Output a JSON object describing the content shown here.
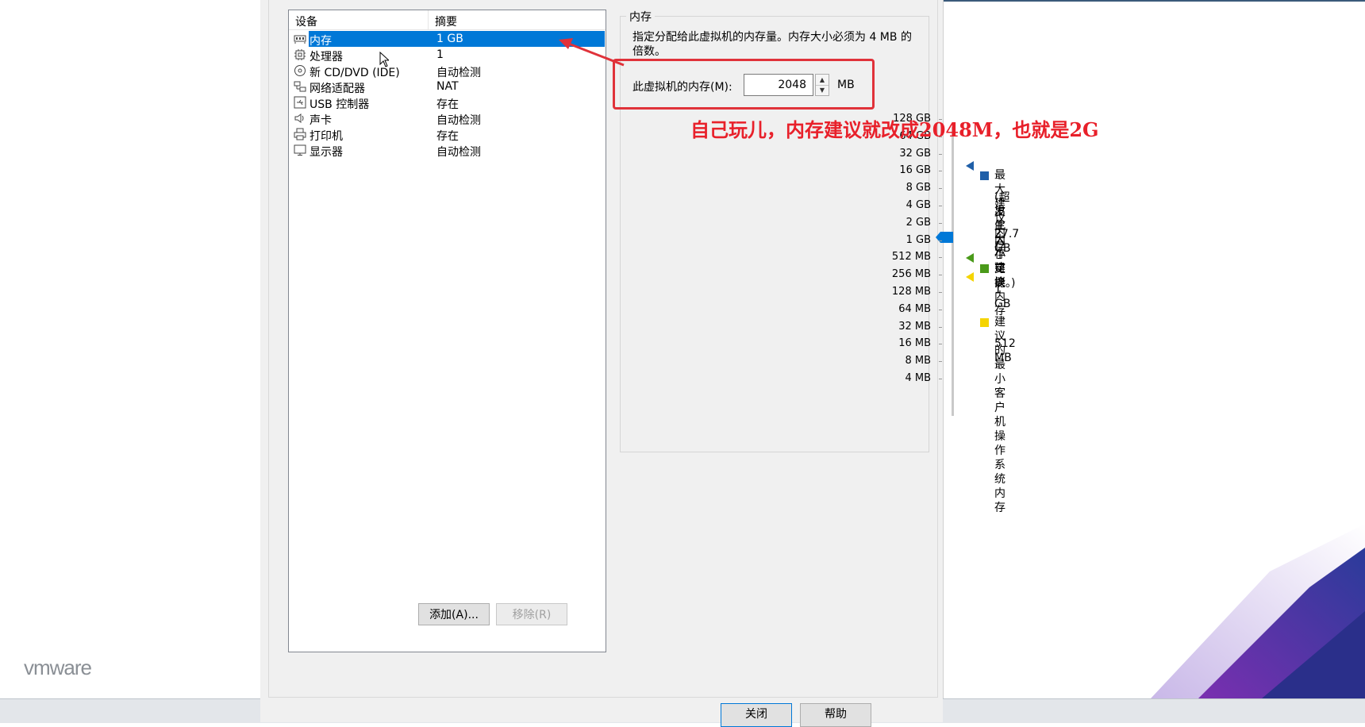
{
  "brand": {
    "logo_text": "vmware"
  },
  "device_list": {
    "headers": {
      "device": "设备",
      "summary": "摘要"
    },
    "rows": [
      {
        "name": "内存",
        "summary": "1 GB",
        "icon": "memory-icon",
        "selected": true
      },
      {
        "name": "处理器",
        "summary": "1",
        "icon": "cpu-icon",
        "selected": false
      },
      {
        "name": "新 CD/DVD (IDE)",
        "summary": "自动检测",
        "icon": "disc-icon",
        "selected": false
      },
      {
        "name": "网络适配器",
        "summary": "NAT",
        "icon": "network-icon",
        "selected": false
      },
      {
        "name": "USB 控制器",
        "summary": "存在",
        "icon": "usb-icon",
        "selected": false
      },
      {
        "name": "声卡",
        "summary": "自动检测",
        "icon": "speaker-icon",
        "selected": false
      },
      {
        "name": "打印机",
        "summary": "存在",
        "icon": "printer-icon",
        "selected": false
      },
      {
        "name": "显示器",
        "summary": "自动检测",
        "icon": "monitor-icon",
        "selected": false
      }
    ],
    "add_button": "添加(A)...",
    "remove_button": "移除(R)"
  },
  "memory_panel": {
    "group_title": "内存",
    "description": "指定分配给此虚拟机的内存量。内存大小必须为 4 MB 的倍数。",
    "field_label": "此虚拟机的内存(M):",
    "value": "2048",
    "unit": "MB",
    "scale": [
      "128 GB",
      "64 GB",
      "32 GB",
      "16 GB",
      "8 GB",
      "4 GB",
      "2 GB",
      "1 GB",
      "512 MB",
      "256 MB",
      "128 MB",
      "64 MB",
      "32 MB",
      "16 MB",
      "8 MB",
      "4 MB"
    ],
    "current_value": "2 GB",
    "legend": {
      "max": {
        "title": "最大建议内存",
        "note_line1": "(超出此大小可能",
        "note_line2": "发生内存交换。)",
        "value": "27.7 GB",
        "color": "#1f5fa8"
      },
      "recommended": {
        "title": "建议内存",
        "value": "1 GB",
        "color": "#4a9a1a"
      },
      "min": {
        "title": "建议的最小客户机操作系统内存",
        "value": "512 MB",
        "color": "#f5d400"
      }
    }
  },
  "annotation": {
    "text": "自己玩儿，内存建议就改成2048M，也就是2G",
    "color": "#e8202a"
  },
  "footer": {
    "close_button": "关闭",
    "help_button": "帮助"
  }
}
